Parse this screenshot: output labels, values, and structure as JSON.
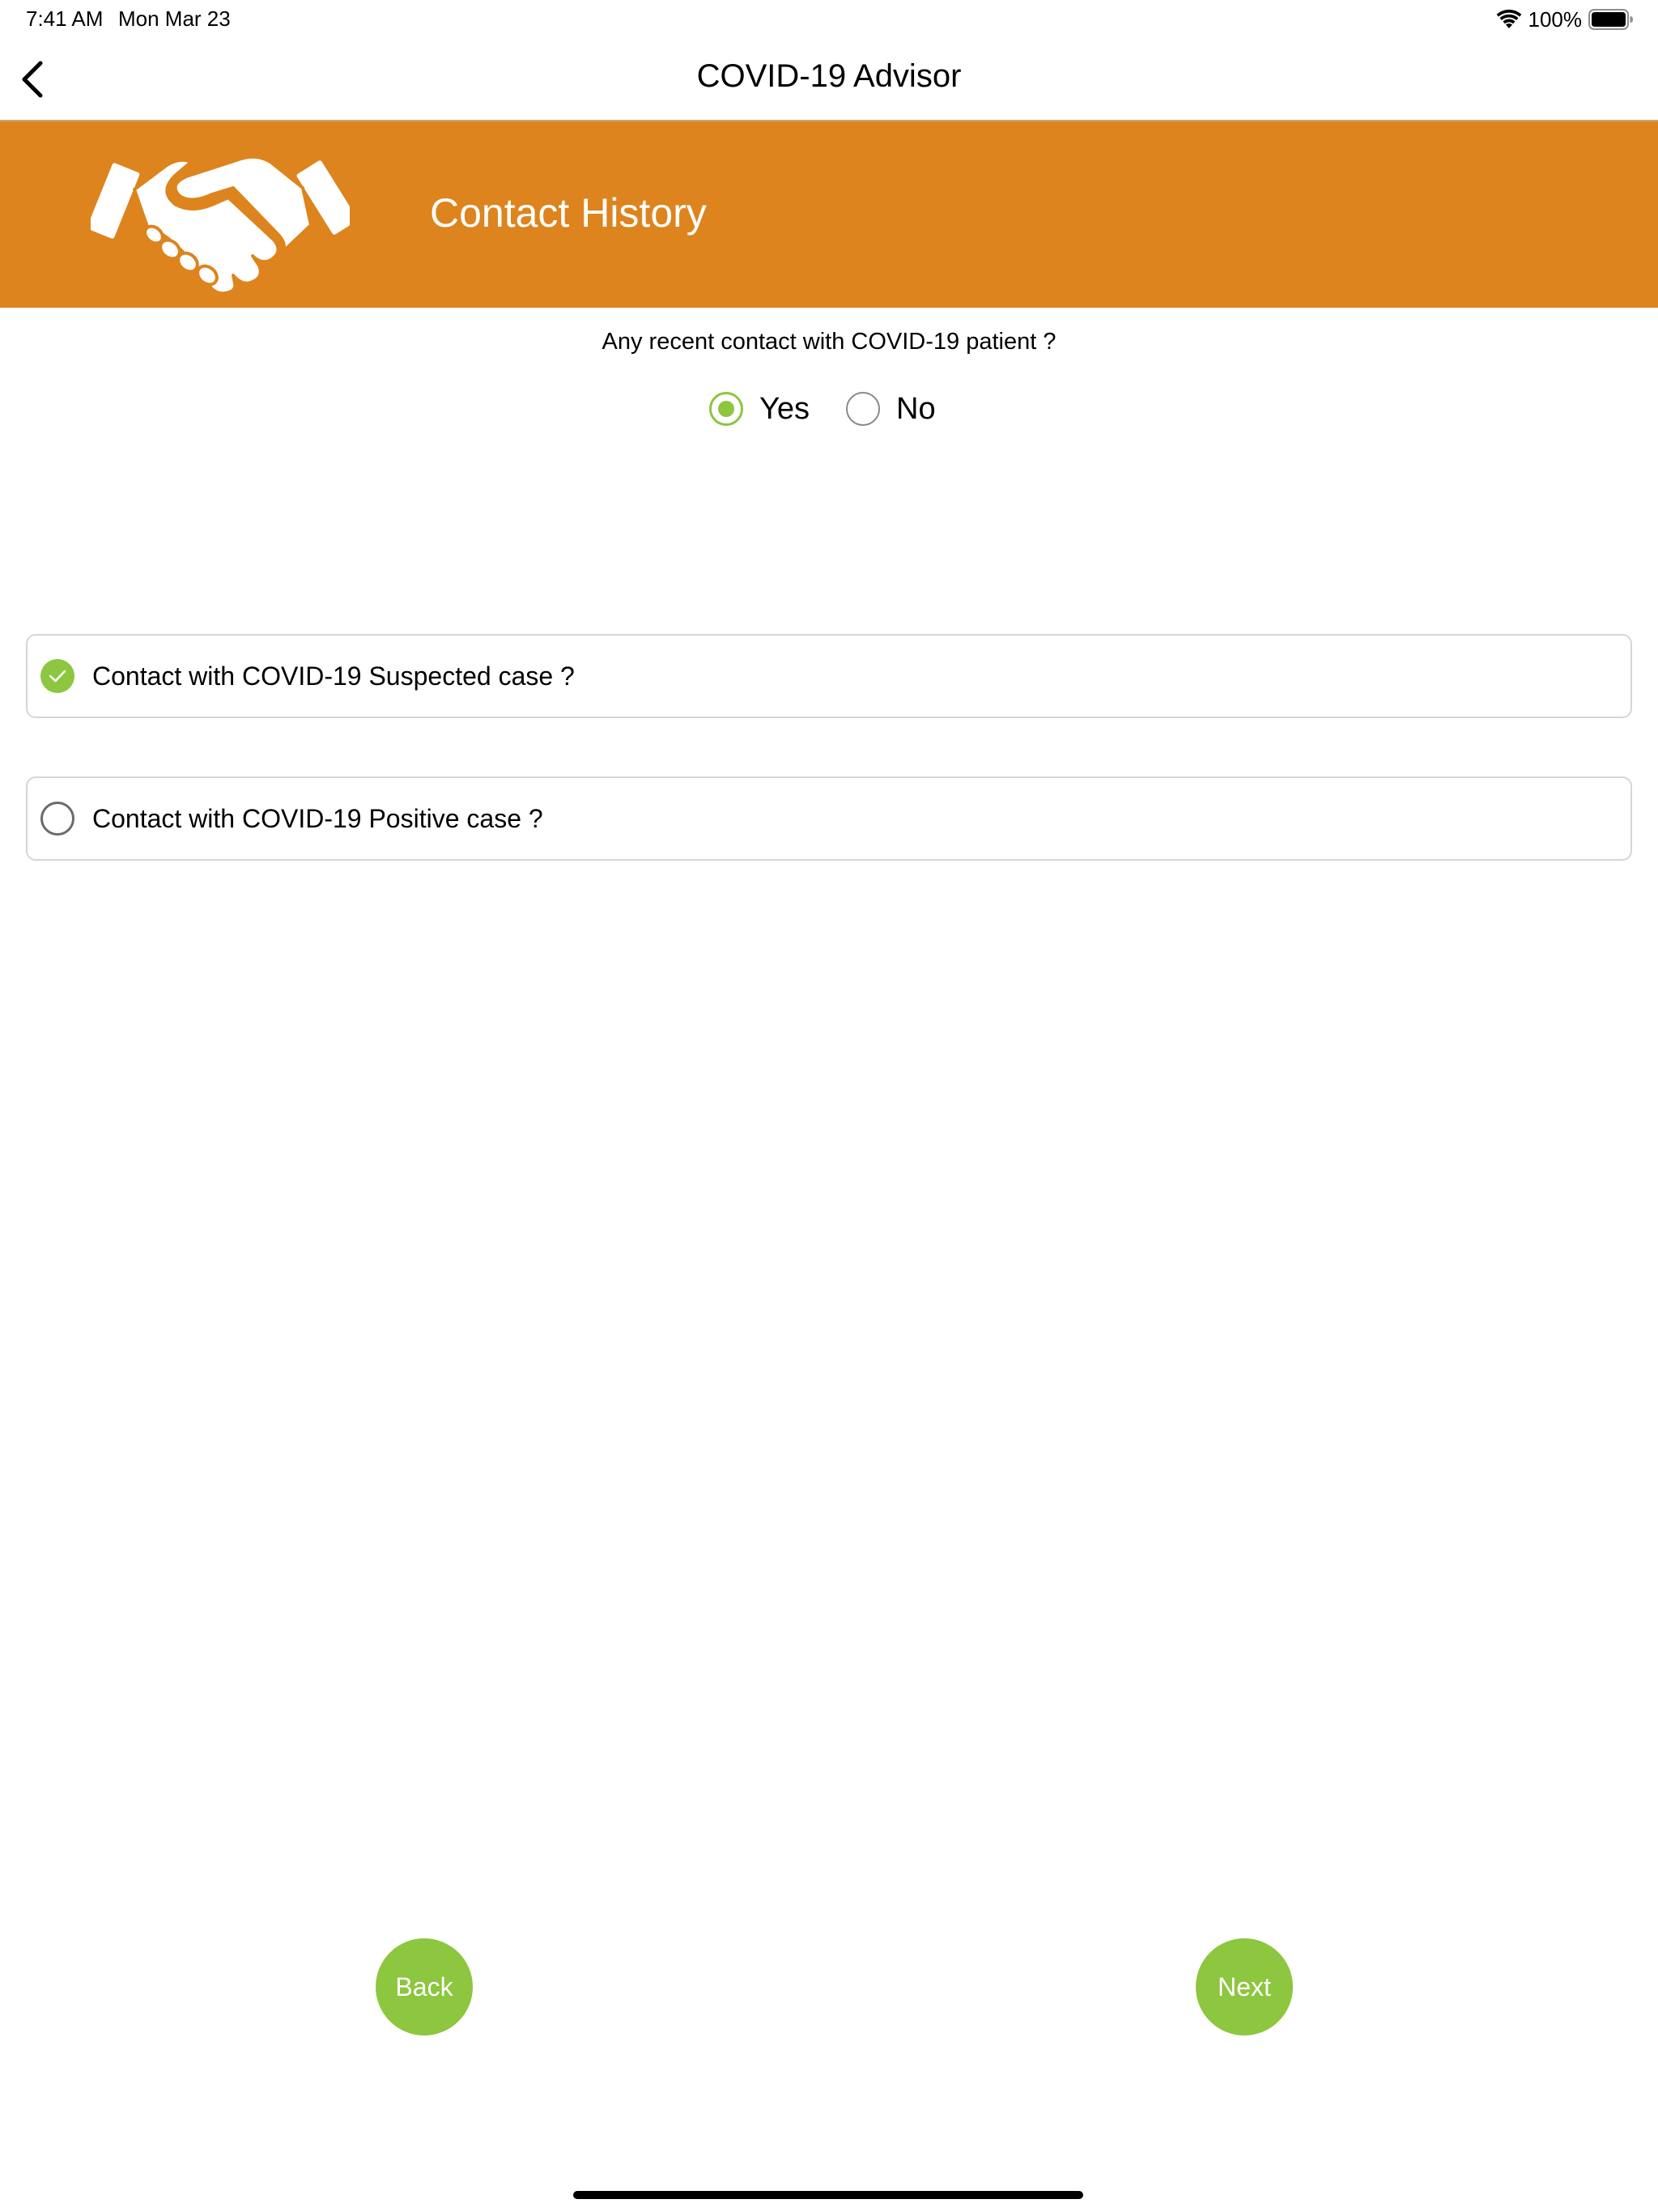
{
  "status_bar": {
    "time": "7:41 AM",
    "date": "Mon Mar 23",
    "battery": "100%",
    "wifi_icon": "wifi-icon",
    "battery_icon": "battery-icon"
  },
  "nav": {
    "title": "COVID-19 Advisor",
    "back_icon": "chevron-left-icon"
  },
  "banner": {
    "title": "Contact History",
    "icon": "handshake-icon",
    "background_color": "#DD841E"
  },
  "question": {
    "text": "Any recent contact with COVID-19 patient ?",
    "options": [
      {
        "label": "Yes",
        "selected": true
      },
      {
        "label": "No",
        "selected": false
      }
    ]
  },
  "contact_options": [
    {
      "label": "Contact with COVID-19 Suspected case ?",
      "checked": true
    },
    {
      "label": "Contact with COVID-19 Positive case ?",
      "checked": false
    }
  ],
  "buttons": {
    "back": "Back",
    "next": "Next",
    "color": "#8DC63F"
  }
}
